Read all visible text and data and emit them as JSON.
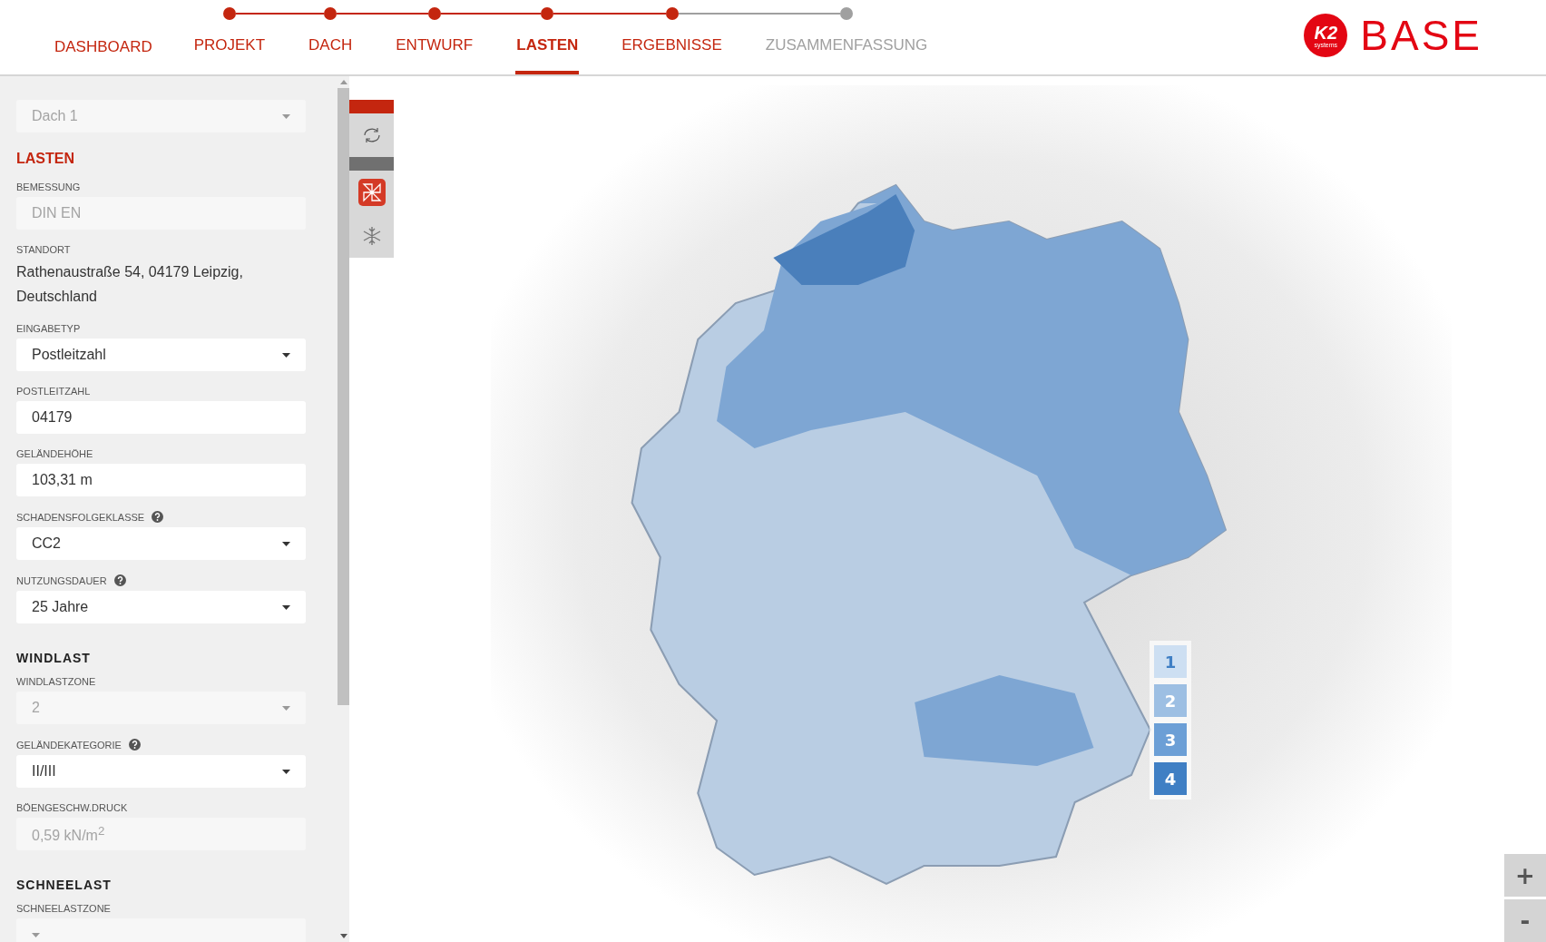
{
  "nav": {
    "dashboard": "DASHBOARD",
    "steps": [
      {
        "label": "PROJEKT",
        "done": true,
        "selected": false
      },
      {
        "label": "DACH",
        "done": true,
        "selected": false
      },
      {
        "label": "ENTWURF",
        "done": true,
        "selected": false
      },
      {
        "label": "LASTEN",
        "done": true,
        "selected": true
      },
      {
        "label": "ERGEBNISSE",
        "done": true,
        "selected": false
      },
      {
        "label": "ZUSAMMENFASSUNG",
        "done": false,
        "selected": false
      }
    ]
  },
  "logo": {
    "mark": "K2",
    "sub": "systems",
    "name": "BASE"
  },
  "sidebar": {
    "roof_select": {
      "value": "Dach 1",
      "disabled": true
    },
    "title": "LASTEN",
    "items": [
      {
        "kind": "input",
        "label": "BEMESSUNG",
        "value": "DIN EN",
        "disabled": true
      },
      {
        "kind": "text",
        "label": "STANDORT",
        "value": "Rathenaustraße 54, 04179 Leipzig, Deutschland"
      },
      {
        "kind": "select",
        "label": "EINGABETYP",
        "value": "Postleitzahl",
        "disabled": false
      },
      {
        "kind": "input",
        "label": "POSTLEITZAHL",
        "value": "04179",
        "disabled": false
      },
      {
        "kind": "input",
        "label": "GELÄNDEHÖHE",
        "value": "103,31 m",
        "disabled": false
      },
      {
        "kind": "select",
        "label": "SCHADENSFOLGEKLASSE",
        "value": "CC2",
        "disabled": false,
        "help": true
      },
      {
        "kind": "select",
        "label": "NUTZUNGSDAUER",
        "value": "25 Jahre",
        "disabled": false,
        "help": true
      },
      {
        "kind": "heading",
        "label": "WINDLAST"
      },
      {
        "kind": "select",
        "label": "WINDLASTZONE",
        "value": "2",
        "disabled": true
      },
      {
        "kind": "select",
        "label": "GELÄNDEKATEGORIE",
        "value": "II/III",
        "disabled": false,
        "help": true
      },
      {
        "kind": "input",
        "label": "BÖENGESCHW.DRUCK",
        "value": "0,59 kN/m$^{2}$",
        "disabled": true
      },
      {
        "kind": "heading",
        "label": "SCHNEELAST"
      },
      {
        "kind": "select",
        "label": "SCHNEELASTZONE",
        "disabled": true
      }
    ]
  },
  "tools": [
    {
      "kind": "refresh",
      "selected": false
    },
    {
      "kind": "wind",
      "selected": true
    },
    {
      "kind": "snow",
      "selected": false
    }
  ],
  "legend": [
    {
      "label": "1",
      "color": "#cddff2"
    },
    {
      "label": "2",
      "color": "#9dbfe3"
    },
    {
      "label": "3",
      "color": "#6c9fd6"
    },
    {
      "label": "4",
      "color": "#3f7fc4"
    }
  ],
  "zoom": {
    "in": "+",
    "out": "-"
  }
}
